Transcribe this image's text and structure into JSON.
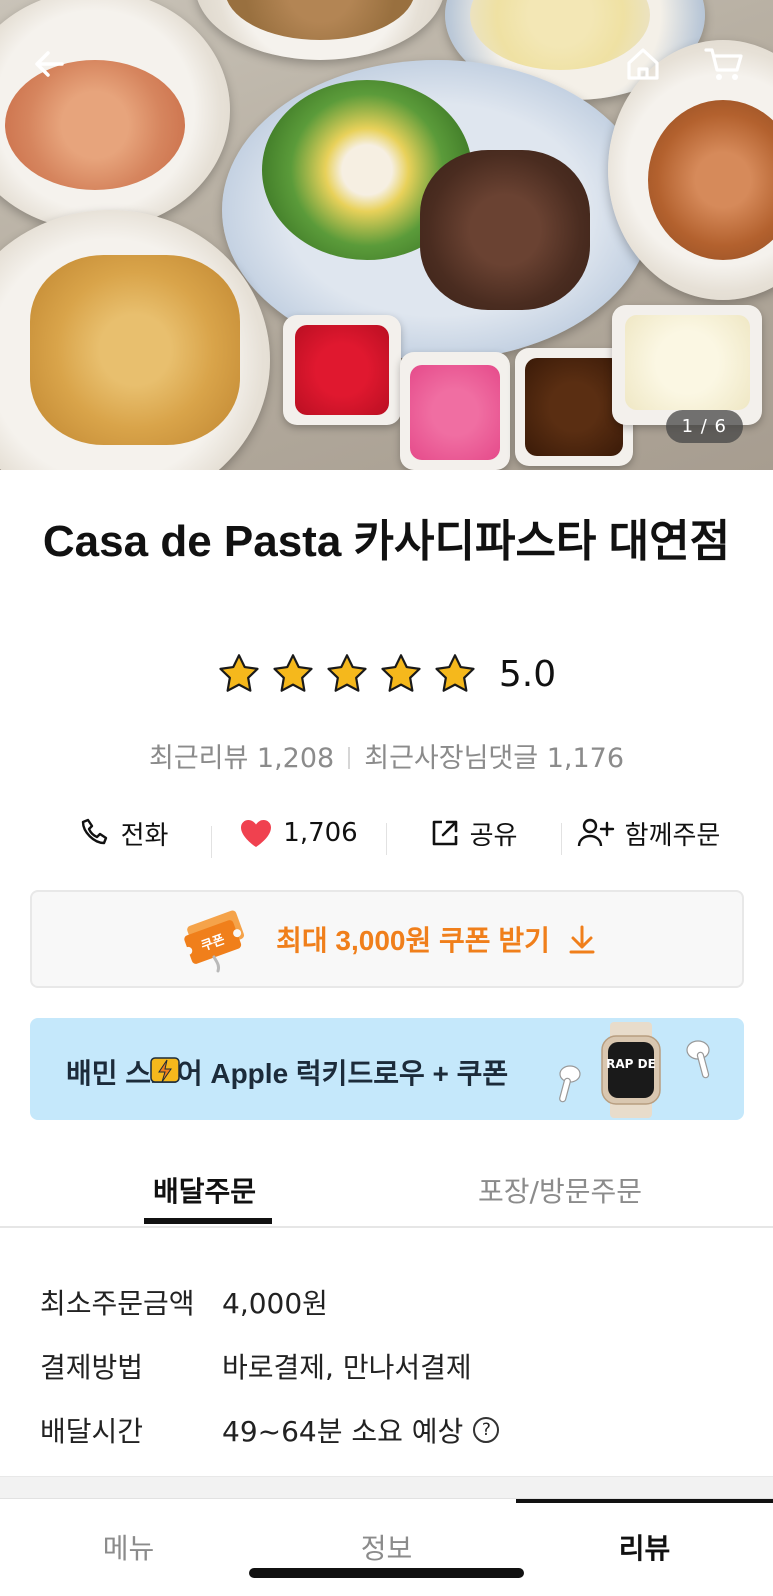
{
  "header": {
    "back_icon": "back-arrow-icon",
    "home_icon": "home-icon",
    "cart_icon": "cart-icon",
    "photo_counter": "1 / 6"
  },
  "store": {
    "name": "Casa de Pasta 카사디파스타 대연점",
    "rating": 5.0,
    "rating_text": "5.0",
    "star_count": 5,
    "recent_reviews_label": "최근리뷰 1,208",
    "recent_owner_replies_label": "최근사장님댓글 1,176"
  },
  "actions": {
    "call_label": "전화",
    "like_count": "1,706",
    "share_label": "공유",
    "group_order_label": "함께주문"
  },
  "coupon": {
    "badge_text": "쿠폰",
    "label": "최대 3,000원 쿠폰 받기"
  },
  "banner": {
    "text": "배민 스토어 Apple 럭키드로우 + 쿠폰",
    "watch_text": "RAP DE"
  },
  "order_tabs": {
    "delivery": "배달주문",
    "pickup": "포장/방문주문",
    "active": "delivery"
  },
  "delivery_info": [
    {
      "label": "최소주문금액",
      "value": "4,000원"
    },
    {
      "label": "결제방법",
      "value": "바로결제, 만나서결제"
    },
    {
      "label": "배달시간",
      "value": "49~64분 소요 예상"
    }
  ],
  "bottom_tabs": {
    "menu": "메뉴",
    "info": "정보",
    "review": "리뷰",
    "active": "review"
  },
  "colors": {
    "accent_orange": "#f07f1b",
    "heart_red": "#f0414f",
    "star_yellow": "#f5b81c",
    "banner_blue": "#c5e8fb"
  }
}
